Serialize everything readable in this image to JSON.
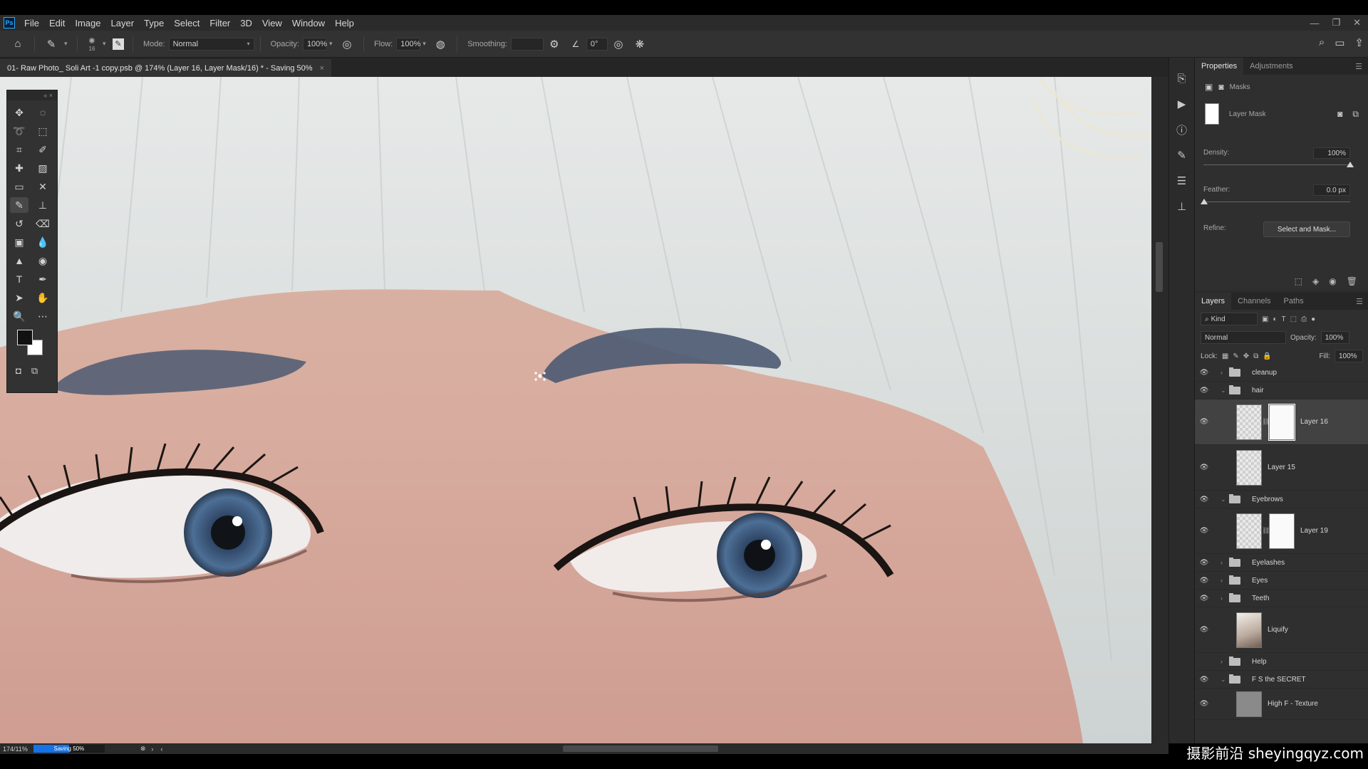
{
  "app": {
    "logo": "Ps"
  },
  "menu": [
    "File",
    "Edit",
    "Image",
    "Layer",
    "Type",
    "Select",
    "Filter",
    "3D",
    "View",
    "Window",
    "Help"
  ],
  "window_controls": [
    "—",
    "❐",
    "✕"
  ],
  "options_bar": {
    "brush_size": "16",
    "mode_label": "Mode:",
    "mode_value": "Normal",
    "opacity_label": "Opacity:",
    "opacity_value": "100%",
    "flow_label": "Flow:",
    "flow_value": "100%",
    "smoothing_label": "Smoothing:",
    "smoothing_value": "",
    "angle_value": "0°"
  },
  "document": {
    "tab_title": "01- Raw Photo_ Soli Art -1 copy.psb @ 174% (Layer 16, Layer Mask/16) * - Saving 50%",
    "close": "×"
  },
  "status": {
    "zoom": "174/11%",
    "progress_label": "Saving 50%",
    "progress": 0.5
  },
  "properties": {
    "tabs": [
      "Properties",
      "Adjustments"
    ],
    "section": "Masks",
    "mask_label": "Layer Mask",
    "density_label": "Density:",
    "density_value": "100%",
    "density": 1.0,
    "feather_label": "Feather:",
    "feather_value": "0.0 px",
    "feather": 0.0,
    "refine_label": "Refine:",
    "select_mask_button": "Select and Mask..."
  },
  "layers_panel": {
    "tabs": [
      "Layers",
      "Channels",
      "Paths"
    ],
    "filter_kind": "Kind",
    "blend_mode": "Normal",
    "opacity_label": "Opacity:",
    "opacity_value": "100%",
    "lock_label": "Lock:",
    "fill_label": "Fill:",
    "fill_value": "100%",
    "layers": [
      {
        "name": "cleanup",
        "type": "group",
        "expanded": false,
        "visible": true
      },
      {
        "name": "hair",
        "type": "group",
        "expanded": true,
        "visible": true
      },
      {
        "name": "Layer 16",
        "type": "layer",
        "mask": true,
        "selected": true,
        "visible": true
      },
      {
        "name": "Layer 15",
        "type": "layer",
        "mask": false,
        "visible": true
      },
      {
        "name": "Eyebrows",
        "type": "group",
        "expanded": true,
        "visible": true
      },
      {
        "name": "Layer 19",
        "type": "layer",
        "mask": true,
        "visible": true
      },
      {
        "name": "Eyelashes",
        "type": "group",
        "expanded": false,
        "visible": true
      },
      {
        "name": "Eyes",
        "type": "group",
        "expanded": false,
        "visible": true
      },
      {
        "name": "Teeth",
        "type": "group",
        "expanded": false,
        "visible": true
      },
      {
        "name": "Liquify",
        "type": "smart",
        "visible": true
      },
      {
        "name": "Help",
        "type": "group",
        "expanded": false,
        "visible": false
      },
      {
        "name": "F S the SECRET",
        "type": "group",
        "expanded": true,
        "visible": true
      },
      {
        "name": "High F - Texture",
        "type": "layer-gray",
        "visible": true
      }
    ]
  },
  "watermark": "摄影前沿 sheyingqyz.com",
  "colors": {
    "accent": "#1473e6",
    "panel": "#2f2f2f",
    "menubar": "#2b2b2b",
    "iris": "#3c5a7e",
    "brow": "#4c5a72"
  }
}
